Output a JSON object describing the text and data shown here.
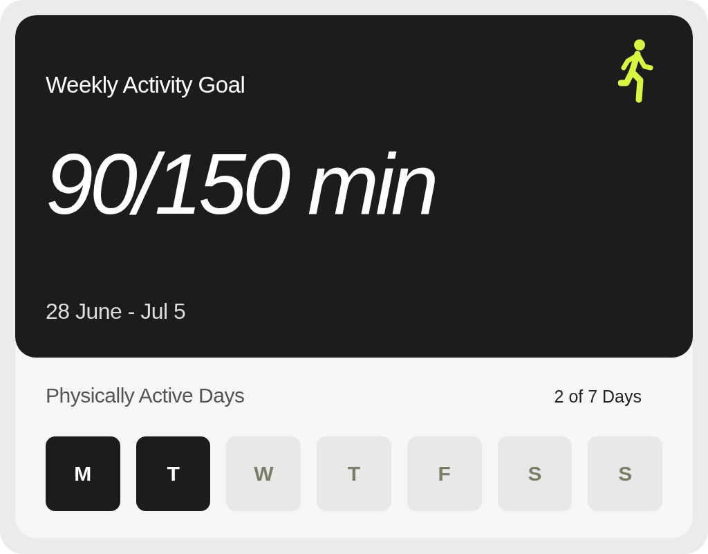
{
  "goal": {
    "title": "Weekly Activity Goal",
    "value": "90/150 min",
    "date_range": "28 June - Jul 5"
  },
  "days_section": {
    "label": "Physically Active Days",
    "summary": "2 of 7 Days",
    "days": [
      {
        "label": "M",
        "active": true
      },
      {
        "label": "T",
        "active": true
      },
      {
        "label": "W",
        "active": false
      },
      {
        "label": "T",
        "active": false
      },
      {
        "label": "F",
        "active": false
      },
      {
        "label": "S",
        "active": false
      },
      {
        "label": "S",
        "active": false
      }
    ]
  }
}
